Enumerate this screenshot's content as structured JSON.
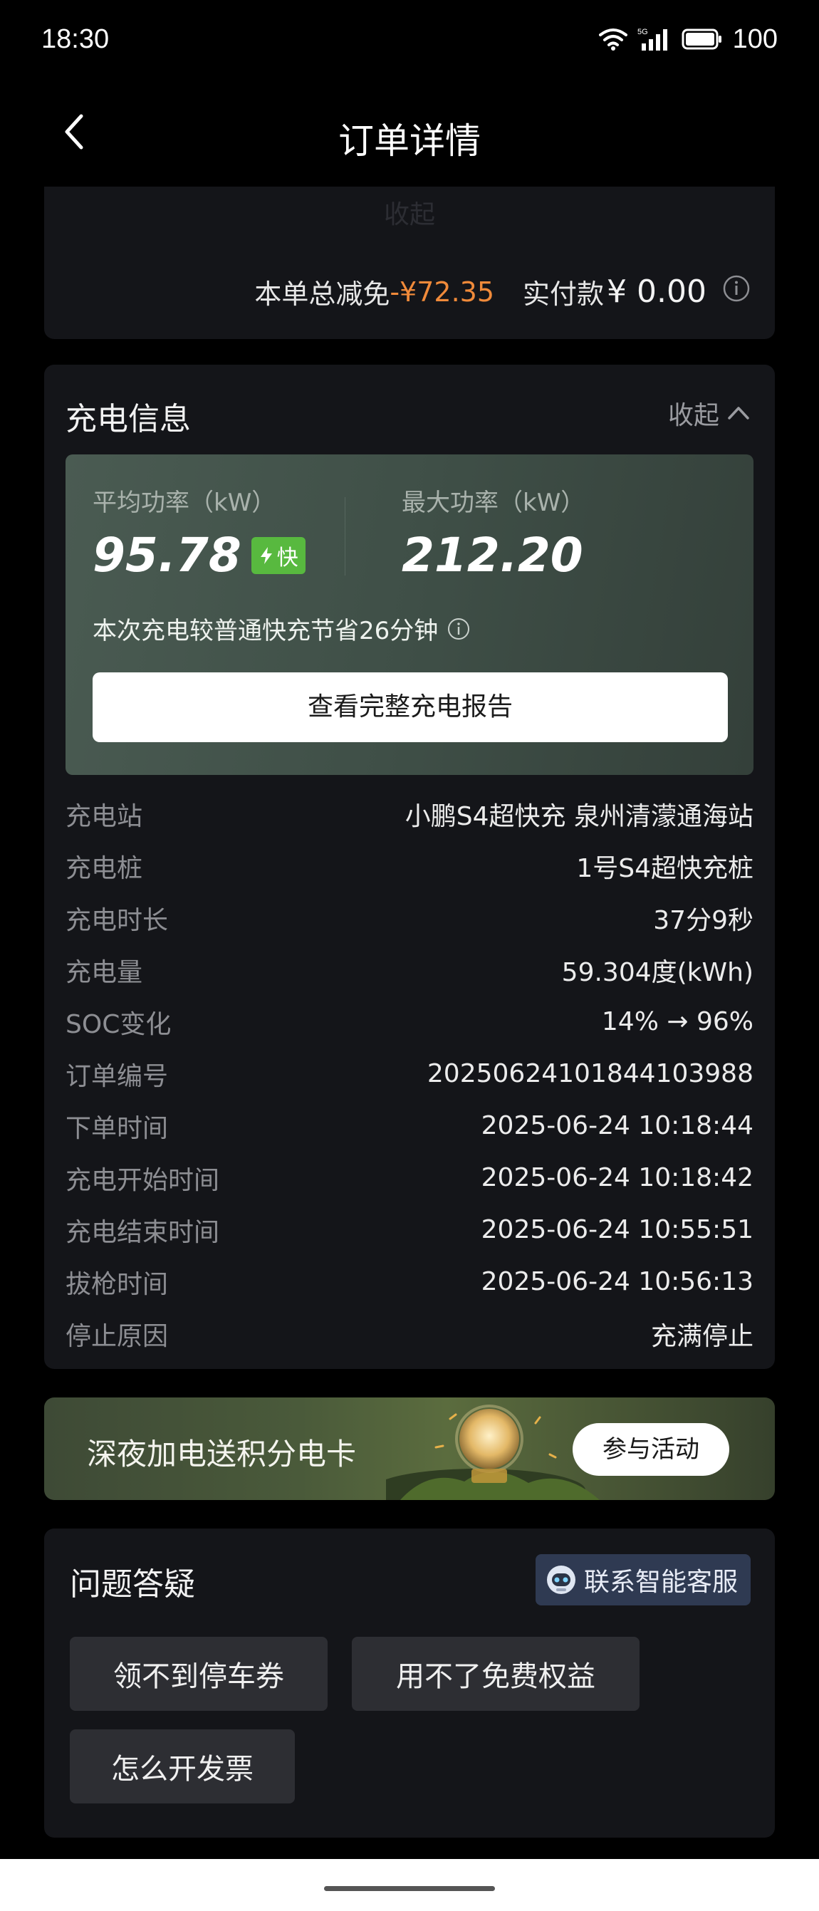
{
  "status_bar": {
    "time": "18:30",
    "network": "5G",
    "battery": "100"
  },
  "nav": {
    "title": "订单详情"
  },
  "summary": {
    "collapsed_label": "收起",
    "total_discount_label": "本单总减免",
    "total_discount_value": "-¥72.35",
    "paid_label": "实付款",
    "paid_value": "¥ 0.00"
  },
  "charging": {
    "title": "充电信息",
    "collapse_label": "收起",
    "avg_power_label": "平均功率（kW）",
    "avg_power_value": "95.78",
    "fast_badge": "快",
    "max_power_label": "最大功率（kW）",
    "max_power_value": "212.20",
    "saving_text": "本次充电较普通快充节省26分钟",
    "report_button": "查看完整充电报告",
    "details": [
      {
        "label": "充电站",
        "value": "小鹏S4超快充 泉州清濛通海站"
      },
      {
        "label": "充电桩",
        "value": "1号S4超快充桩"
      },
      {
        "label": "充电时长",
        "value": "37分9秒"
      },
      {
        "label": "充电量",
        "value": "59.304度(kWh)"
      },
      {
        "label": "SOC变化",
        "value": "14% → 96%"
      },
      {
        "label": "订单编号",
        "value": "20250624101844103988"
      },
      {
        "label": "下单时间",
        "value": "2025-06-24 10:18:44"
      },
      {
        "label": "充电开始时间",
        "value": "2025-06-24 10:18:42"
      },
      {
        "label": "充电结束时间",
        "value": "2025-06-24 10:55:51"
      },
      {
        "label": "拔枪时间",
        "value": "2025-06-24 10:56:13"
      },
      {
        "label": "停止原因",
        "value": "充满停止"
      }
    ]
  },
  "promo": {
    "text": "深夜加电送积分电卡",
    "button": "参与活动"
  },
  "faq": {
    "title": "问题答疑",
    "support_button": "联系智能客服",
    "chips": [
      "领不到停车券",
      "用不了免费权益",
      "怎么开发票"
    ]
  },
  "colors": {
    "discount": "#f08a3a",
    "badge": "#58b93f",
    "panel": "#45554d"
  }
}
